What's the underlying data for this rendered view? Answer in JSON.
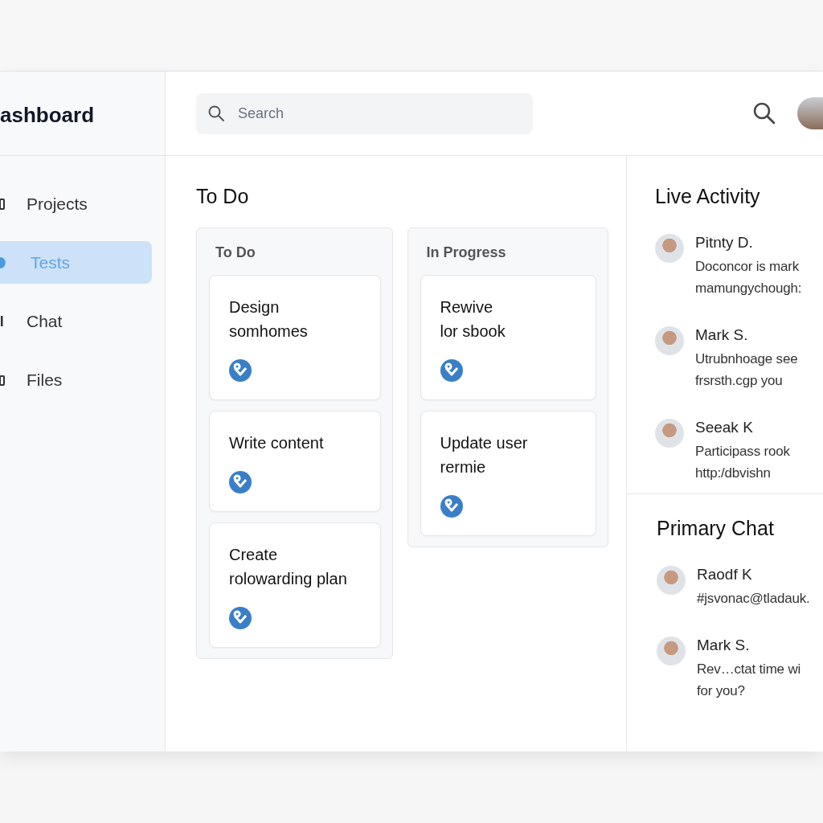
{
  "sidebar": {
    "brand": "ashboard",
    "items": [
      {
        "label": "Projects",
        "selected": false
      },
      {
        "label": "Tests",
        "selected": true
      },
      {
        "label": "Chat",
        "selected": false
      },
      {
        "label": "Files",
        "selected": false
      }
    ]
  },
  "header": {
    "search": {
      "placeholder": "Search"
    }
  },
  "board": {
    "title": "To Do",
    "columns": [
      {
        "title": "To Do",
        "cards": [
          {
            "title": "Design\nsomhomes"
          },
          {
            "title": "Write content"
          },
          {
            "title": "Create\nrolowarding plan"
          }
        ]
      },
      {
        "title": "In Progress",
        "cards": [
          {
            "title": "Rewive\nlor sbook"
          },
          {
            "title": "Update user\nrermie"
          }
        ]
      }
    ]
  },
  "live_activity": {
    "title": "Live Activity",
    "items": [
      {
        "name": "Pitnty D.",
        "message": "Doconcor is mark\nmamungychough:"
      },
      {
        "name": "Mark S.",
        "message": "Utrubnhoage see\nfrsrsth.cgp you"
      },
      {
        "name": "Seeak K",
        "message": "Participass rook\nhttp:/dbvishn"
      }
    ]
  },
  "primary_chat": {
    "title": "Primary Chat",
    "items": [
      {
        "name": "Raodf K",
        "message": "#jsvonac@tladauk."
      },
      {
        "name": "Mark S.",
        "message": "Rev…ctat time wi\nfor you?"
      }
    ]
  }
}
